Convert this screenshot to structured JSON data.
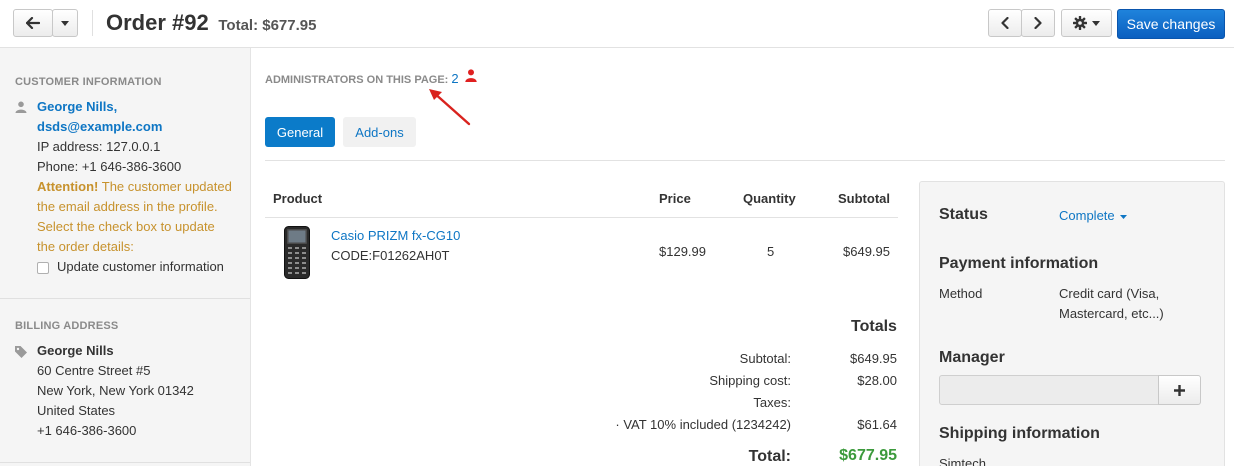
{
  "header": {
    "order_title": "Order #92",
    "order_total": "Total: $677.95",
    "save_label": "Save changes"
  },
  "sidebar": {
    "customer": {
      "section_title": "CUSTOMER INFORMATION",
      "name": "George Nills,",
      "email": "dsds@example.com",
      "ip": "IP address: 127.0.0.1",
      "phone": "Phone: +1 646-386-3600",
      "attention_bold": "Attention!",
      "attention_lines": [
        " The customer updated",
        "the email address in the profile.",
        "Select the check box to update",
        "the order details:"
      ],
      "update_label": "Update customer information"
    },
    "billing": {
      "section_title": "BILLING ADDRESS",
      "name": "George Nills",
      "street": "60 Centre Street #5",
      "city": "New York, New York 01342",
      "country": "United States",
      "phone": "+1 646-386-3600"
    }
  },
  "main": {
    "admins_label": "ADMINISTRATORS ON THIS PAGE:",
    "admins_count": "2",
    "tabs": [
      {
        "label": "General",
        "active": true
      },
      {
        "label": "Add-ons",
        "active": false
      }
    ],
    "table": {
      "columns": [
        "Product",
        "Price",
        "Quantity",
        "Subtotal"
      ],
      "rows": [
        {
          "name": "Casio PRIZM fx-CG10",
          "code": "CODE:F01262AH0T",
          "price": "$129.99",
          "quantity": "5",
          "subtotal": "$649.95"
        }
      ]
    },
    "totals": {
      "heading": "Totals",
      "subtotal_label": "Subtotal:",
      "subtotal_value": "$649.95",
      "shipping_label": "Shipping cost:",
      "shipping_value": "$28.00",
      "taxes_label": "Taxes:",
      "vat_label": "· VAT 10% included (1234242)",
      "vat_value": "$61.64",
      "total_label": "Total:",
      "total_value": "$677.95"
    }
  },
  "panel": {
    "status_heading": "Status",
    "status_value": "Complete",
    "payment_heading": "Payment information",
    "method_label": "Method",
    "method_value_lines": [
      "Credit card (Visa,",
      "Mastercard, etc...)"
    ],
    "manager_heading": "Manager",
    "shipping_heading": "Shipping information",
    "shipping_carrier": "Simtech"
  },
  "colors": {
    "accent": "#0b7bc9",
    "link": "#0e76c4",
    "attention": "#c7922d",
    "total_green": "#3c9a3c",
    "admin_icon": "#e02020",
    "arrow": "#d9231e"
  },
  "icons": {
    "back": "arrow-left-icon",
    "dropdown": "caret-down-icon",
    "prev": "chevron-left-icon",
    "next": "chevron-right-icon",
    "settings": "gear-icon",
    "customer": "user-icon",
    "billing": "tag-icon",
    "admin": "user-icon",
    "add_manager": "plus-icon"
  }
}
